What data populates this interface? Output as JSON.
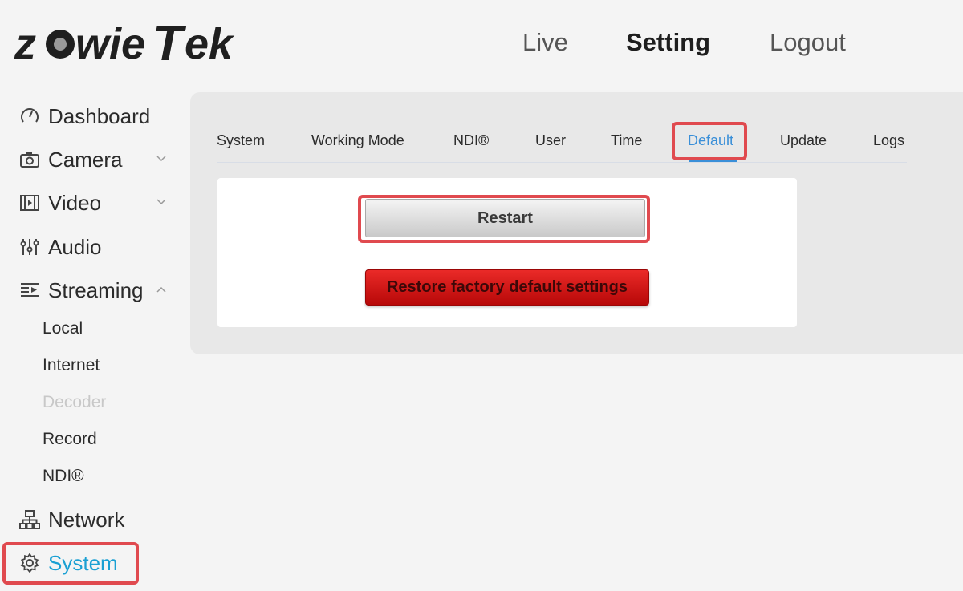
{
  "brand": {
    "logo_text": "zowieTek"
  },
  "top_nav": [
    {
      "label": "Live"
    },
    {
      "label": "Setting",
      "active": true
    },
    {
      "label": "Logout"
    }
  ],
  "sidebar": {
    "items": [
      {
        "label": "Dashboard",
        "icon": "dashboard-gauge-icon"
      },
      {
        "label": "Camera",
        "icon": "camera-icon",
        "chevron": "chevron-down-icon"
      },
      {
        "label": "Video",
        "icon": "film-icon",
        "chevron": "chevron-down-icon"
      },
      {
        "label": "Audio",
        "icon": "audio-mixer-icon"
      },
      {
        "label": "Streaming",
        "icon": "streaming-icon",
        "chevron": "chevron-up-icon"
      },
      {
        "label": "Network",
        "icon": "network-icon"
      },
      {
        "label": "System",
        "icon": "gear-icon",
        "active": true
      }
    ],
    "streaming_sub": [
      {
        "label": "Local"
      },
      {
        "label": "Internet"
      },
      {
        "label": "Decoder",
        "disabled": true
      },
      {
        "label": "Record"
      },
      {
        "label": "NDI®"
      }
    ]
  },
  "tabs": [
    {
      "label": "System"
    },
    {
      "label": "Working Mode"
    },
    {
      "label": "NDI®"
    },
    {
      "label": "User"
    },
    {
      "label": "Time"
    },
    {
      "label": "Default",
      "active": true
    },
    {
      "label": "Update"
    },
    {
      "label": "Logs"
    }
  ],
  "actions": {
    "restart_label": "Restart",
    "factory_label": "Restore factory default settings"
  },
  "colors": {
    "accent": "#1aa0d3",
    "tab_active": "#3a8fd8",
    "highlight": "#e04a4f",
    "danger": "#d41717"
  }
}
